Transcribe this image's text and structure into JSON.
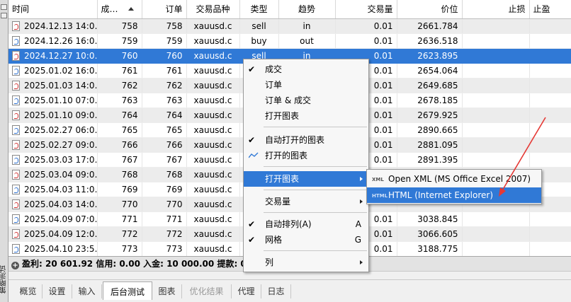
{
  "side_panel": {
    "label": "策略测试"
  },
  "table": {
    "columns": [
      "时间",
      "成…",
      "订单",
      "交易品种",
      "类型",
      "趋势",
      "交易量",
      "价位",
      "止损",
      "止盈"
    ],
    "rows": [
      {
        "time": "2024.12.13 14:0…",
        "deal": "758",
        "order": "758",
        "symbol": "xauusd.c",
        "type": "sell",
        "direction": "in",
        "volume": "0.01",
        "price": "2661.784",
        "icon": "sell",
        "state": "shaded"
      },
      {
        "time": "2024.12.26 16:0…",
        "deal": "759",
        "order": "759",
        "symbol": "xauusd.c",
        "type": "buy",
        "direction": "out",
        "volume": "0.01",
        "price": "2636.518",
        "icon": "buy",
        "state": ""
      },
      {
        "time": "2024.12.27 10:0…",
        "deal": "760",
        "order": "760",
        "symbol": "xauusd.c",
        "type": "sell",
        "direction": "in",
        "volume": "0.01",
        "price": "2623.895",
        "icon": "sell",
        "state": "selected"
      },
      {
        "time": "2025.01.02 16:0…",
        "deal": "761",
        "order": "761",
        "symbol": "xauusd.c",
        "type": "",
        "direction": "",
        "volume": "0.01",
        "price": "2654.064",
        "icon": "buy",
        "state": ""
      },
      {
        "time": "2025.01.03 14:0…",
        "deal": "762",
        "order": "762",
        "symbol": "xauusd.c",
        "type": "",
        "direction": "",
        "volume": "0.01",
        "price": "2649.685",
        "icon": "sell",
        "state": "shaded"
      },
      {
        "time": "2025.01.10 07:0…",
        "deal": "763",
        "order": "763",
        "symbol": "xauusd.c",
        "type": "",
        "direction": "",
        "volume": "0.01",
        "price": "2678.185",
        "icon": "buy",
        "state": ""
      },
      {
        "time": "2025.01.10 09:0…",
        "deal": "764",
        "order": "764",
        "symbol": "xauusd.c",
        "type": "",
        "direction": "",
        "volume": "0.01",
        "price": "2679.925",
        "icon": "sell",
        "state": "shaded"
      },
      {
        "time": "2025.02.27 06:0…",
        "deal": "765",
        "order": "765",
        "symbol": "xauusd.c",
        "type": "",
        "direction": "",
        "volume": "0.01",
        "price": "2890.665",
        "icon": "buy",
        "state": ""
      },
      {
        "time": "2025.02.27 09:0…",
        "deal": "766",
        "order": "766",
        "symbol": "xauusd.c",
        "type": "",
        "direction": "",
        "volume": "0.01",
        "price": "2881.095",
        "icon": "sell",
        "state": "shaded"
      },
      {
        "time": "2025.03.03 17:0…",
        "deal": "767",
        "order": "767",
        "symbol": "xauusd.c",
        "type": "",
        "direction": "",
        "volume": "0.01",
        "price": "2891.395",
        "icon": "buy",
        "state": ""
      },
      {
        "time": "2025.03.04 09:0…",
        "deal": "768",
        "order": "768",
        "symbol": "xauusd.c",
        "type": "",
        "direction": "",
        "volume": "",
        "price": "",
        "icon": "sell",
        "state": "shaded"
      },
      {
        "time": "2025.04.03 11:0…",
        "deal": "769",
        "order": "769",
        "symbol": "xauusd.c",
        "type": "",
        "direction": "",
        "volume": "",
        "price": "",
        "icon": "buy",
        "state": ""
      },
      {
        "time": "2025.04.03 14:0…",
        "deal": "770",
        "order": "770",
        "symbol": "xauusd.c",
        "type": "",
        "direction": "",
        "volume": "",
        "price": "",
        "icon": "sell",
        "state": "shaded"
      },
      {
        "time": "2025.04.09 07:0…",
        "deal": "771",
        "order": "771",
        "symbol": "xauusd.c",
        "type": "",
        "direction": "",
        "volume": "0.01",
        "price": "3038.845",
        "icon": "buy",
        "state": ""
      },
      {
        "time": "2025.04.09 12:0…",
        "deal": "772",
        "order": "772",
        "symbol": "xauusd.c",
        "type": "",
        "direction": "",
        "volume": "0.01",
        "price": "3066.605",
        "icon": "sell",
        "state": "shaded"
      },
      {
        "time": "2025.04.10 23:5…",
        "deal": "773",
        "order": "773",
        "symbol": "xauusd.c",
        "type": "",
        "direction": "",
        "volume": "0.01",
        "price": "3188.775",
        "icon": "buy",
        "state": ""
      }
    ]
  },
  "summary": {
    "text": "盈利: 20 601.92  信用: 0.00  入金: 10 000.00  提款: 0.00"
  },
  "tabs": [
    "概览",
    "设置",
    "输入",
    "后台测试",
    "图表",
    "优化结果",
    "代理",
    "日志"
  ],
  "context_menu": [
    {
      "label": "成交",
      "check": true,
      "shortcut": "",
      "submenu": false
    },
    {
      "label": "订单",
      "check": false,
      "shortcut": "",
      "submenu": false
    },
    {
      "label": "订单 & 成交",
      "check": false,
      "shortcut": "",
      "submenu": false
    },
    {
      "label": "打开图表",
      "check": false,
      "shortcut": "",
      "submenu": false
    },
    {
      "label": "自动打开的图表",
      "check": true,
      "shortcut": "",
      "submenu": false
    },
    {
      "label": "打开的图表",
      "check": false,
      "shortcut": "",
      "submenu": false
    },
    {
      "label": "打开图表",
      "check": false,
      "shortcut": "",
      "submenu": true
    },
    {
      "label": "交易量",
      "check": false,
      "shortcut": "",
      "submenu": true
    },
    {
      "label": "自动排列(A)",
      "check": true,
      "shortcut": "A",
      "submenu": false
    },
    {
      "label": "网格",
      "check": true,
      "shortcut": "G",
      "submenu": false
    },
    {
      "label": "列",
      "check": false,
      "shortcut": "",
      "submenu": true
    }
  ],
  "submenu": [
    {
      "tag": "XML",
      "label": "Open XML (MS Office Excel 2007)"
    },
    {
      "tag": "HTML",
      "label": "HTML (Internet Explorer)"
    }
  ],
  "colors": {
    "selection": "#3079d6",
    "annotation_arrow": "#e53935"
  }
}
